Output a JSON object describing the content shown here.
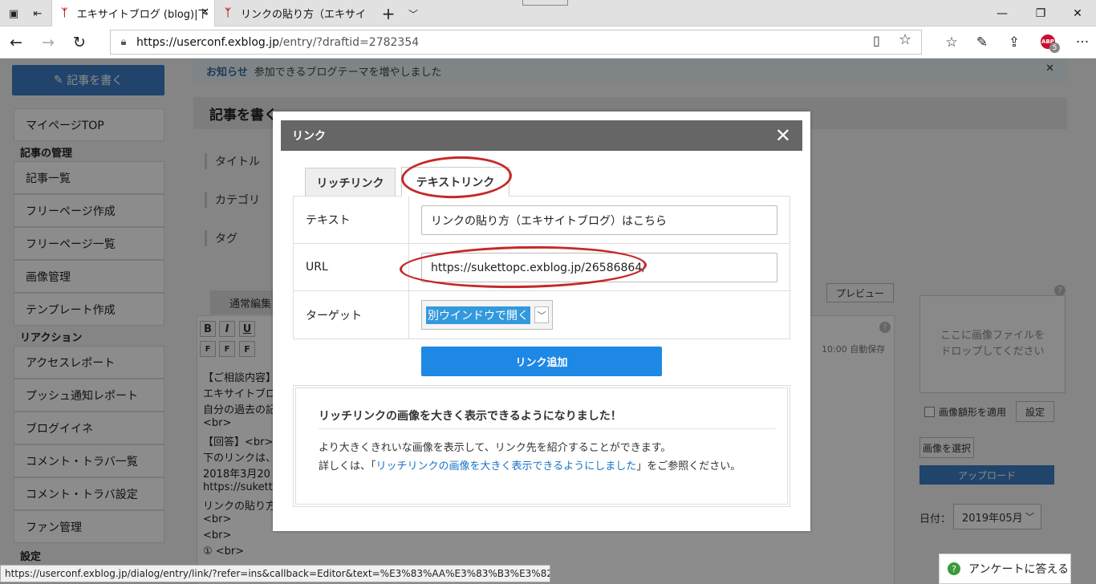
{
  "browser": {
    "tabs": [
      {
        "title": "エキサイトブログ (blog)|下記"
      },
      {
        "title": "リンクの貼り方（エキサイトブログ"
      }
    ],
    "url_host": "https://userconf.exblog.jp",
    "url_path": "/entry/?draftid=2782354",
    "abp_label": "ABP",
    "abp_count": "5",
    "status_url": "https://userconf.exblog.jp/dialog/entry/link/?refer=ins&callback=Editor&text=%E3%83%AA%E3%83%B3%E3%82%AF%E3%81%"
  },
  "page": {
    "write_button": "記事を書く",
    "sidebar": {
      "top": "マイページTOP",
      "section_manage": "記事の管理",
      "items_manage": [
        "記事一覧",
        "フリーページ作成",
        "フリーページ一覧",
        "画像管理",
        "テンプレート作成"
      ],
      "section_reaction": "リアクション",
      "items_reaction": [
        "アクセスレポート",
        "プッシュ通知レポート",
        "ブログイイネ",
        "コメント・トラバ一覧",
        "コメント・トラバ設定",
        "ファン管理"
      ],
      "section_settings": "設定"
    },
    "notice_label": "お知らせ",
    "notice_text": "参加できるブログテーマを増やしました",
    "heading": "記事を書く",
    "fields": [
      "タイトル",
      "カテゴリ",
      "タグ"
    ],
    "editor_tab": "通常編集",
    "preview": "プレビュー",
    "autosave": "10:00 自動保存",
    "editor_lines": [
      "【ご相談内容】",
      "エキサイトブロ",
      "自分の過去の記",
      "<br>",
      "【回答】<br>",
      "下のリンクは、",
      "2018年3月20",
      "https://sukett",
      "リンクの貼り方",
      "<br>",
      "<br>",
      "① <br>"
    ],
    "dropzone_line1": "ここに画像ファイルを",
    "dropzone_line2": "ドロップしてください",
    "frame_label": "画像額形を適用",
    "setting_btn": "設定",
    "select_image_btn": "画像を選択",
    "upload_btn": "アップロード",
    "date_label": "日付：",
    "date_value": "2019年05月",
    "survey": "アンケートに答える"
  },
  "dialog": {
    "title": "リンク",
    "tabs": [
      "リッチリンク",
      "テキストリンク"
    ],
    "active_tab": "テキストリンク",
    "rows": {
      "text_label": "テキスト",
      "text_value": "リンクの貼り方（エキサイトブログ）はこちら",
      "url_label": "URL",
      "url_value": "https://sukettopc.exblog.jp/26586864/",
      "target_label": "ターゲット",
      "target_value": "別ウインドウで開く"
    },
    "add_button": "リンク追加",
    "info": {
      "title": "リッチリンクの画像を大きく表示できるようになりました！",
      "line1": "より大きくきれいな画像を表示して、リンク先を紹介することができます。",
      "line2_before": "詳しくは、「",
      "line2_link": "リッチリンクの画像を大きく表示できるようにしました",
      "line2_after": "」をご参照ください。"
    }
  },
  "colors": {
    "accent": "#1e88e5",
    "annotation": "#c62828",
    "header": "#666666"
  }
}
